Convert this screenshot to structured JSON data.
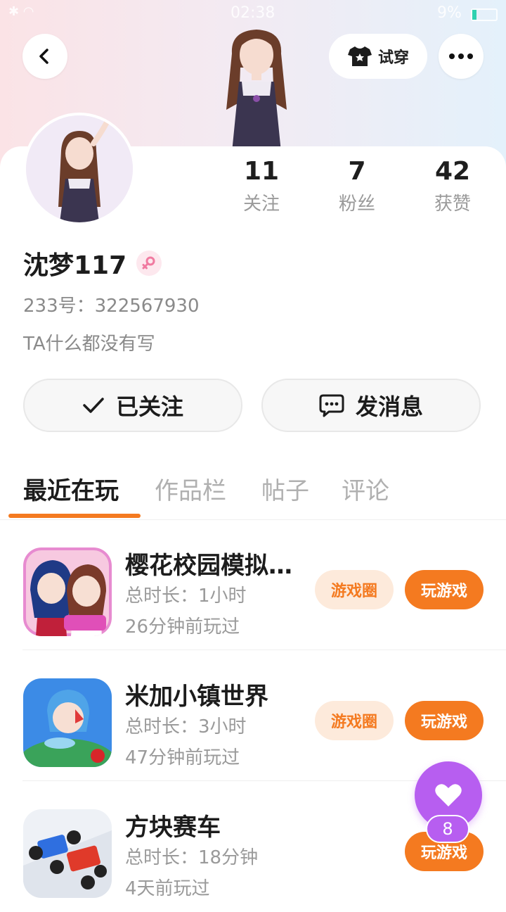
{
  "status_bar": {
    "time": "02:38",
    "battery": "9%"
  },
  "header": {
    "try_on_label": "试穿"
  },
  "profile": {
    "name": "沈梦117",
    "uid_line": "233号：322567930",
    "bio": "TA什么都没有写",
    "stats": [
      {
        "value": "11",
        "label": "关注"
      },
      {
        "value": "7",
        "label": "粉丝"
      },
      {
        "value": "42",
        "label": "获赞"
      }
    ]
  },
  "actions": {
    "follow_label": "已关注",
    "message_label": "发消息"
  },
  "tabs": [
    "最近在玩",
    "作品栏",
    "帖子",
    "评论"
  ],
  "games": [
    {
      "name": "樱花校园模拟…",
      "duration": "总时长：1小时",
      "last_played": "26分钟前玩过",
      "circle_label": "游戏圈",
      "play_label": "玩游戏",
      "icon": "sakura-school-icon"
    },
    {
      "name": "米加小镇世界",
      "duration": "总时长：3小时",
      "last_played": "47分钟前玩过",
      "circle_label": "游戏圈",
      "play_label": "玩游戏",
      "icon": "miga-town-icon"
    },
    {
      "name": "方块赛车",
      "duration": "总时长：18分钟",
      "last_played": "4天前玩过",
      "play_label": "玩游戏",
      "icon": "block-racer-icon"
    }
  ],
  "float_like": {
    "count": "8"
  },
  "colors": {
    "accent": "#f47a20",
    "like_purple": "#b75ef0"
  }
}
